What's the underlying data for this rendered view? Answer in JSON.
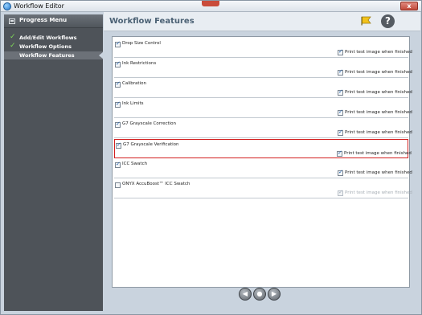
{
  "window": {
    "title": "Workflow Editor",
    "close_label": "x"
  },
  "sidebar": {
    "title": "Progress Menu",
    "items": [
      {
        "label": "Add/Edit Workflows",
        "done": true
      },
      {
        "label": "Workflow Options",
        "done": true
      },
      {
        "label": "Workflow Features",
        "done": false,
        "active": true
      }
    ]
  },
  "main": {
    "title": "Workflow Features",
    "help_label": "?"
  },
  "features": [
    {
      "name": "Drop Size Control",
      "checked": true,
      "print_label": "Print test image when finished",
      "print_checked": true,
      "print_enabled": true,
      "selected": false
    },
    {
      "name": "Ink Restrictions",
      "checked": true,
      "print_label": "Print test image when finished",
      "print_checked": true,
      "print_enabled": true,
      "selected": false
    },
    {
      "name": "Calibration",
      "checked": true,
      "print_label": "Print test image when finished",
      "print_checked": true,
      "print_enabled": true,
      "selected": false
    },
    {
      "name": "Ink Limits",
      "checked": true,
      "print_label": "Print test image when finished",
      "print_checked": true,
      "print_enabled": true,
      "selected": false
    },
    {
      "name": "G7 Grayscale Correction",
      "checked": true,
      "print_label": "Print test image when finished",
      "print_checked": true,
      "print_enabled": true,
      "selected": false
    },
    {
      "name": "G7 Grayscale Verification",
      "checked": true,
      "print_label": "Print test image when finished",
      "print_checked": true,
      "print_enabled": true,
      "selected": true
    },
    {
      "name": "ICC Swatch",
      "checked": true,
      "print_label": "Print test image when finished",
      "print_checked": true,
      "print_enabled": true,
      "selected": false
    },
    {
      "name": "ONYX AccuBoost™ ICC Swatch",
      "checked": false,
      "print_label": "Print test image when finished",
      "print_checked": true,
      "print_enabled": false,
      "selected": false
    }
  ],
  "footer": {
    "back_label": "◀",
    "mid_label": "●",
    "finish_label": "▶"
  },
  "colors": {
    "sidebar_bg": "#4e5359",
    "panel_bg": "#c9d3de",
    "check_green": "#7ed957",
    "selected_border": "#d31f1f"
  }
}
